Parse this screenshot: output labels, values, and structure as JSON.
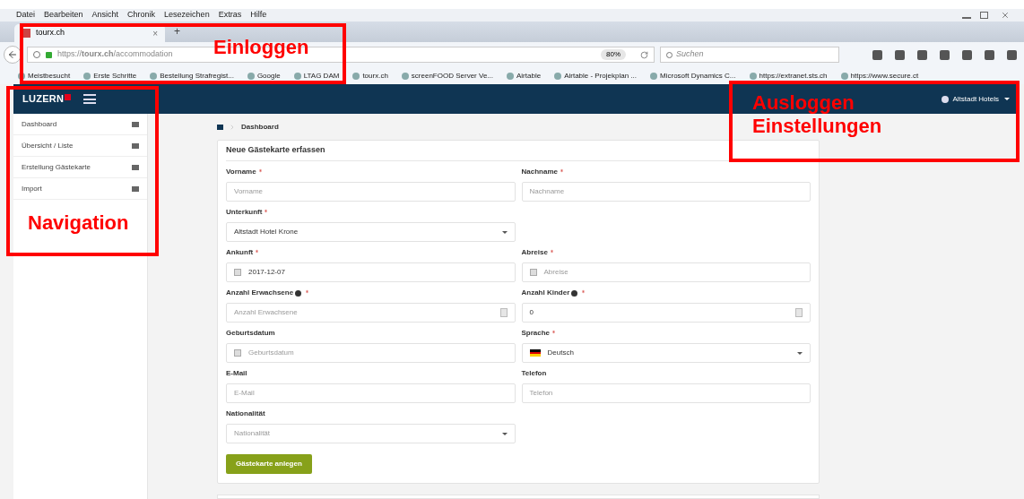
{
  "browser": {
    "menu": [
      "Datei",
      "Bearbeiten",
      "Ansicht",
      "Chronik",
      "Lesezeichen",
      "Extras",
      "Hilfe"
    ],
    "tab": {
      "title": "tourx.ch",
      "close": "×",
      "new": "+"
    },
    "address": "https://**tourx.ch**/accommodation",
    "zoom": "80%",
    "search": {
      "placeholder": "Suchen"
    },
    "bookmarks": [
      "Meistbesucht",
      "Erste Schritte",
      "Bestellung Strafregist...",
      "Google",
      "LTAG DAM",
      "tourx.ch",
      "screenFOOD Server Ve...",
      "Airtable",
      "Airtable - Projekplan ...",
      "Microsoft Dynamics C...",
      "https://extranet.sts.ch",
      "https://www.secure.ct"
    ]
  },
  "app": {
    "logo": "LUZERN",
    "user": "Altstadt Hotels",
    "sidebar": [
      {
        "label": "Dashboard"
      },
      {
        "label": "Übersicht / Liste"
      },
      {
        "label": "Erstellung Gästekarte"
      },
      {
        "label": "Import"
      }
    ],
    "breadcrumb": "Dashboard",
    "card_title": "Neue Gästekarte erfassen",
    "rows": [
      [
        {
          "kind": "text",
          "label": "Vorname",
          "required": true,
          "info": false,
          "placeholder": "Vorname"
        },
        {
          "kind": "text",
          "label": "Nachname",
          "required": true,
          "info": false,
          "placeholder": "Nachname"
        }
      ],
      [
        {
          "kind": "select",
          "label": "Unterkunft",
          "required": true,
          "info": false,
          "value": "Altstadt Hotel Krone"
        }
      ],
      [
        {
          "kind": "date",
          "label": "Ankunft",
          "required": true,
          "info": false,
          "value": "2017-12-07"
        },
        {
          "kind": "date",
          "label": "Abreise",
          "required": true,
          "info": false,
          "placeholder": "Abreise"
        }
      ],
      [
        {
          "kind": "number",
          "label": "Anzahl Erwachsene",
          "required": true,
          "info": true,
          "placeholder": "Anzahl Erwachsene"
        },
        {
          "kind": "number",
          "label": "Anzahl Kinder",
          "required": true,
          "info": true,
          "value": "0"
        }
      ],
      [
        {
          "kind": "date",
          "label": "Geburtsdatum",
          "required": false,
          "info": false,
          "placeholder": "Geburtsdatum"
        },
        {
          "kind": "language",
          "label": "Sprache",
          "required": true,
          "info": false,
          "value": "Deutsch"
        }
      ],
      [
        {
          "kind": "text",
          "label": "E-Mail",
          "required": false,
          "info": false,
          "placeholder": "E-Mail"
        },
        {
          "kind": "text",
          "label": "Telefon",
          "required": false,
          "info": false,
          "placeholder": "Telefon"
        }
      ],
      [
        {
          "kind": "select",
          "label": "Nationalität",
          "required": false,
          "info": false,
          "placeholder": "Nationalität"
        }
      ]
    ],
    "submit": "Gästekarte anlegen"
  },
  "annotations": [
    {
      "kind": "login",
      "lines": [
        "Einloggen"
      ]
    },
    {
      "kind": "nav",
      "lines": [
        "Navigation"
      ]
    },
    {
      "kind": "account",
      "lines": [
        "Ausloggen",
        "Einstellungen"
      ]
    }
  ]
}
